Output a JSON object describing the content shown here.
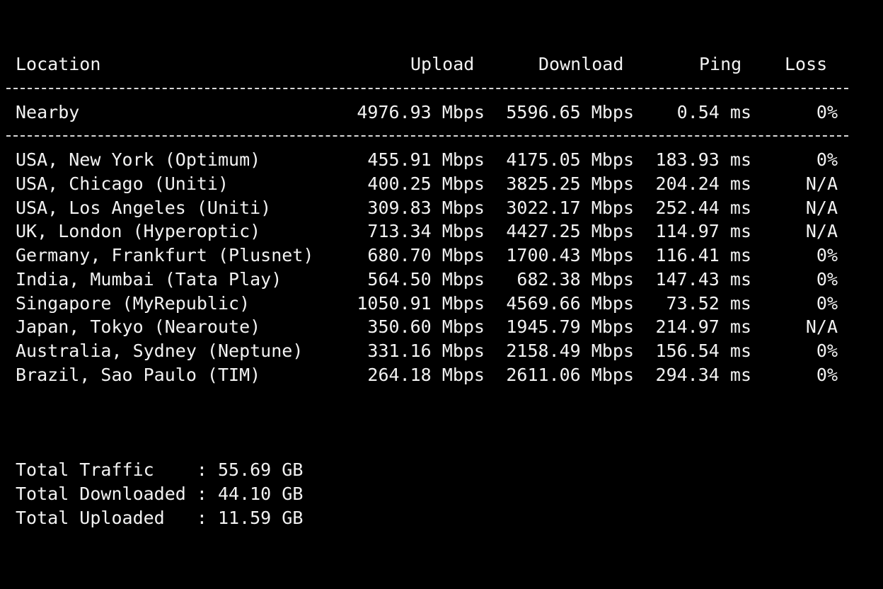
{
  "colors": {
    "background": "#000000",
    "text": "#f2f2f2"
  },
  "header": {
    "location": "Location",
    "upload": "Upload",
    "download": "Download",
    "ping": "Ping",
    "loss": "Loss"
  },
  "nearby": {
    "location": "Nearby",
    "upload": "4976.93 Mbps",
    "download": "5596.65 Mbps",
    "ping": "0.54 ms",
    "loss": "0%"
  },
  "rows": [
    {
      "location": "USA, New York (Optimum)",
      "upload": "455.91 Mbps",
      "download": "4175.05 Mbps",
      "ping": "183.93 ms",
      "loss": "0%"
    },
    {
      "location": "USA, Chicago (Uniti)",
      "upload": "400.25 Mbps",
      "download": "3825.25 Mbps",
      "ping": "204.24 ms",
      "loss": "N/A"
    },
    {
      "location": "USA, Los Angeles (Uniti)",
      "upload": "309.83 Mbps",
      "download": "3022.17 Mbps",
      "ping": "252.44 ms",
      "loss": "N/A"
    },
    {
      "location": "UK, London (Hyperoptic)",
      "upload": "713.34 Mbps",
      "download": "4427.25 Mbps",
      "ping": "114.97 ms",
      "loss": "N/A"
    },
    {
      "location": "Germany, Frankfurt (Plusnet)",
      "upload": "680.70 Mbps",
      "download": "1700.43 Mbps",
      "ping": "116.41 ms",
      "loss": "0%"
    },
    {
      "location": "India, Mumbai (Tata Play)",
      "upload": "564.50 Mbps",
      "download": "682.38 Mbps",
      "ping": "147.43 ms",
      "loss": "0%"
    },
    {
      "location": "Singapore (MyRepublic)",
      "upload": "1050.91 Mbps",
      "download": "4569.66 Mbps",
      "ping": "73.52 ms",
      "loss": "0%"
    },
    {
      "location": "Japan, Tokyo (Nearoute)",
      "upload": "350.60 Mbps",
      "download": "1945.79 Mbps",
      "ping": "214.97 ms",
      "loss": "N/A"
    },
    {
      "location": "Australia, Sydney (Neptune)",
      "upload": "331.16 Mbps",
      "download": "2158.49 Mbps",
      "ping": "156.54 ms",
      "loss": "0%"
    },
    {
      "location": "Brazil, Sao Paulo (TIM)",
      "upload": "264.18 Mbps",
      "download": "2611.06 Mbps",
      "ping": "294.34 ms",
      "loss": "0%"
    }
  ],
  "summary": {
    "total_traffic": "Total Traffic    : 55.69 GB",
    "total_downloaded": "Total Downloaded : 44.10 GB",
    "total_uploaded": "Total Uploaded   : 11.59 GB"
  }
}
